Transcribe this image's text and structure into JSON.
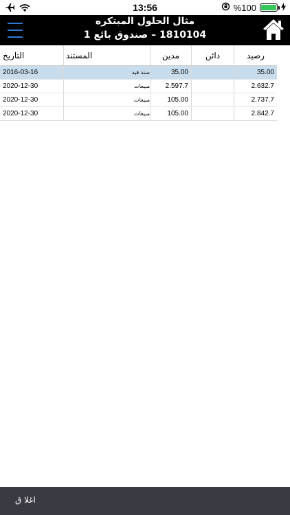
{
  "status_bar": {
    "time": "13:56",
    "battery_label": "%100",
    "battery_level": 1.0,
    "battery_color": "#34c759",
    "icons": [
      "airplane-icon",
      "wifi-icon",
      "orientation-lock-icon",
      "battery-icon",
      "charging-icon"
    ]
  },
  "header": {
    "title": "مثال الحلول المبتكره",
    "subtitle": "1810104 – صندوق بائع 1",
    "menu_icon": "hamburger-icon",
    "home_icon": "home-icon",
    "accent_color": "#2d7ad8"
  },
  "table": {
    "columns": {
      "date": "التاريخ",
      "document": "المستند",
      "debit": "مدين",
      "credit": "دائن",
      "balance": "رصيد"
    },
    "rows": [
      {
        "date": "2016-03-16",
        "document": "سند قيد",
        "debit": "35.00",
        "credit": "",
        "balance": "35.00",
        "selected": true
      },
      {
        "date": "2020-12-30",
        "document": "مبيعات",
        "debit": "2.597.7",
        "credit": "",
        "balance": "2.632.7",
        "selected": false
      },
      {
        "date": "2020-12-30",
        "document": "مبيعات",
        "debit": "105.00",
        "credit": "",
        "balance": "2.737.7",
        "selected": false
      },
      {
        "date": "2020-12-30",
        "document": "مبيعات",
        "debit": "105.00",
        "credit": "",
        "balance": "2.842.7",
        "selected": false
      }
    ]
  },
  "footer": {
    "close_label": "اغلا ق"
  }
}
